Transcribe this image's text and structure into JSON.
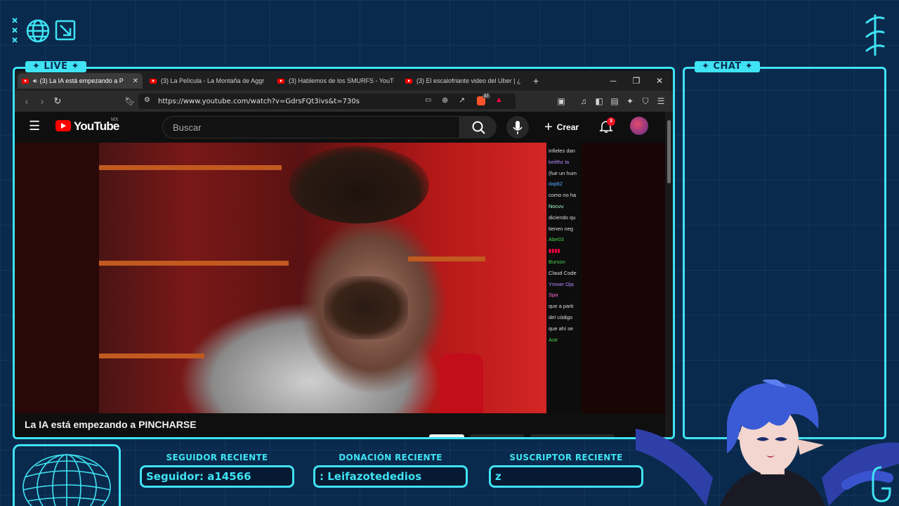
{
  "overlay": {
    "live_badge": "LIVE",
    "chat_badge": "CHAT",
    "stats": [
      {
        "label": "SEGUIDOR RECIENTE",
        "value": "Seguidor: a14566"
      },
      {
        "label": "DONACIÓN RECIENTE",
        "value": ": Leifazotededios"
      },
      {
        "label": "SUSCRIPTOR RECIENTE",
        "value": "z"
      }
    ],
    "accent_color": "#3fe3f3",
    "background_color": "#0a2a4d"
  },
  "browser": {
    "tabs": [
      {
        "label": "(3) La IA está empezando a P",
        "active": true
      },
      {
        "label": "(3) La Película - La Montaña de Aggr",
        "active": false
      },
      {
        "label": "(3) Hablemos de los SMURFS - YouTu",
        "active": false
      },
      {
        "label": "(3) El escalofriante video del Uber | ¿",
        "active": false
      }
    ],
    "new_tab": "+",
    "url": "https://www.youtube.com/watch?v=GdrsFQt3ivs&t=730s",
    "extension_count": "37"
  },
  "youtube": {
    "logo": "YouTube",
    "region": "MX",
    "search_placeholder": "Buscar",
    "create_label": "Crear",
    "notifications": "3",
    "video_title": "La IA está empezando a PINCHARSE",
    "side_chat": [
      "infieles dan",
      "keilthz  la",
      "(fue un hum",
      "daji82",
      "como no ha",
      "Nocvu",
      "diciendo qu",
      "tienen neg",
      "Abe03",
      "Burson",
      "Claud Code",
      "Ymner  Oja",
      "Spa",
      "que a parti",
      "del código",
      "que ahí se",
      "Astr"
    ]
  }
}
